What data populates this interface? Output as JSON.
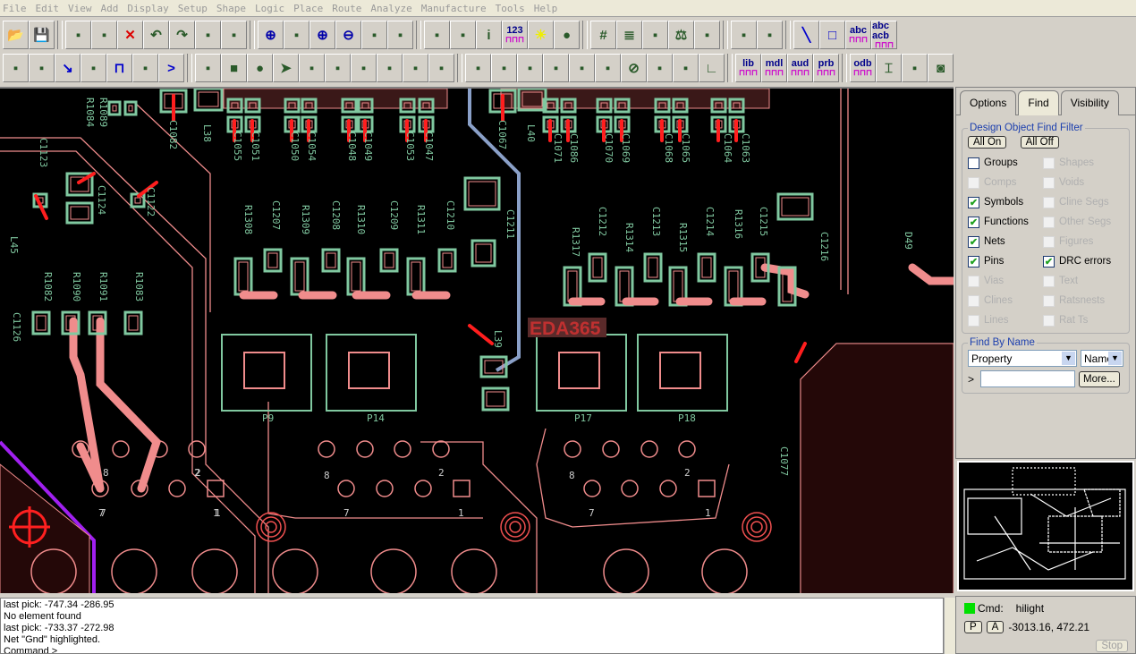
{
  "menu": [
    "File",
    "Edit",
    "View",
    "Add",
    "Display",
    "Setup",
    "Shape",
    "Logic",
    "Place",
    "Route",
    "Analyze",
    "Manufacture",
    "Tools",
    "Help"
  ],
  "toolbar": {
    "row1": [
      {
        "icon": "open-folder-icon"
      },
      {
        "icon": "save-icon"
      },
      {
        "sep": true
      },
      {
        "icon": "move-icon"
      },
      {
        "icon": "copy-icon"
      },
      {
        "icon": "delete-icon"
      },
      {
        "icon": "undo-icon"
      },
      {
        "icon": "redo-icon"
      },
      {
        "icon": "unrats-icon"
      },
      {
        "icon": "pin-icon"
      },
      {
        "sep": true
      },
      {
        "icon": "zoom-fit-icon"
      },
      {
        "icon": "zoom-points-icon"
      },
      {
        "icon": "zoom-in-icon"
      },
      {
        "icon": "zoom-out-icon"
      },
      {
        "icon": "zoom-previous-icon"
      },
      {
        "icon": "redraw-icon"
      },
      {
        "sep": true
      },
      {
        "icon": "color-icon"
      },
      {
        "icon": "color-assign-icon"
      },
      {
        "icon": "info-icon"
      },
      {
        "icon": "measure-icon",
        "label": "123"
      },
      {
        "icon": "highlight-icon"
      },
      {
        "icon": "dehighlight-icon"
      },
      {
        "sep": true
      },
      {
        "icon": "grid-icon"
      },
      {
        "icon": "layers-icon"
      },
      {
        "icon": "visibility-icon"
      },
      {
        "icon": "balance-icon"
      },
      {
        "icon": "board-icon"
      },
      {
        "sep": true
      },
      {
        "icon": "swap-icon"
      },
      {
        "icon": "placement-icon"
      },
      {
        "sep": true
      },
      {
        "icon": "line-icon"
      },
      {
        "icon": "rectangle-icon"
      },
      {
        "icon": "add-text-icon",
        "label": "abc"
      },
      {
        "icon": "change-text-icon",
        "label": "abc acb"
      }
    ],
    "row2": [
      {
        "icon": "connect-icon"
      },
      {
        "icon": "slide-icon"
      },
      {
        "icon": "route-icon"
      },
      {
        "icon": "fanout-icon"
      },
      {
        "icon": "delay-tune-icon"
      },
      {
        "icon": "custom-smooth-icon"
      },
      {
        "icon": "vertex-icon"
      },
      {
        "sep": true
      },
      {
        "icon": "shape-edit-icon"
      },
      {
        "icon": "shape-add-rect-icon"
      },
      {
        "icon": "shape-add-circle-icon"
      },
      {
        "icon": "select-shape-icon"
      },
      {
        "icon": "void-icon"
      },
      {
        "icon": "void-circle-icon"
      },
      {
        "icon": "void-rect-icon"
      },
      {
        "icon": "void-ellipse-icon"
      },
      {
        "icon": "island-icon"
      },
      {
        "icon": "merge-shape-icon"
      },
      {
        "sep": true
      },
      {
        "icon": "dimension-icon"
      },
      {
        "icon": "datum-icon"
      },
      {
        "icon": "linear-dim-icon"
      },
      {
        "icon": "ordinate-dim-icon"
      },
      {
        "icon": "angular-dim-icon"
      },
      {
        "icon": "leader-icon"
      },
      {
        "icon": "diameter-icon"
      },
      {
        "icon": "radius-icon"
      },
      {
        "icon": "balloon-icon"
      },
      {
        "icon": "chamfer-icon"
      },
      {
        "sep": true
      },
      {
        "icon": "lib-icon",
        "label": "lib"
      },
      {
        "icon": "mdl-icon",
        "label": "mdl"
      },
      {
        "icon": "aud-icon",
        "label": "aud"
      },
      {
        "icon": "prb-icon",
        "label": "prb"
      },
      {
        "sep": true
      },
      {
        "icon": "odb-icon",
        "label": "odb"
      },
      {
        "icon": "drill-icon"
      },
      {
        "icon": "drill-legend-icon"
      },
      {
        "icon": "camera-icon"
      }
    ]
  },
  "canvas": {
    "watermark": "EDA365",
    "refdes": [
      "R1084",
      "R1089",
      "C1082",
      "L38",
      "C1055",
      "C1051",
      "C1050",
      "C1054",
      "C1048",
      "C1049",
      "C1053",
      "C1047",
      "C1067",
      "L40",
      "C1071",
      "C1086",
      "C1070",
      "C1069",
      "C1068",
      "C1065",
      "C1064",
      "C1063",
      "C1123",
      "C1124",
      "C1122",
      "L45",
      "R1308",
      "C1207",
      "R1309",
      "C1208",
      "R1310",
      "C1209",
      "R1311",
      "C1210",
      "C1211",
      "R1317",
      "C1212",
      "R1314",
      "C1213",
      "R1315",
      "C1214",
      "R1316",
      "C1215",
      "C1216",
      "D49",
      "R1082",
      "R1090",
      "R1091",
      "R1083",
      "C1126",
      "L39",
      "C1077"
    ],
    "connectors": [
      "P9",
      "P14",
      "P17",
      "P18"
    ],
    "pin_numbers": [
      "8",
      "2",
      "7",
      "1",
      "8",
      "2",
      "7",
      "1",
      "8",
      "2",
      "7",
      "1",
      "2",
      "1",
      "7"
    ],
    "colors": {
      "background": "#000000",
      "pad": "#80c8a0",
      "trace": "#f08c8c",
      "highlight": "#ff1e1e",
      "gnd_net": "#8aa0c8",
      "power": "#a020f0"
    }
  },
  "panel": {
    "tabs": [
      "Options",
      "Find",
      "Visibility"
    ],
    "active_tab": "Find",
    "filter_title": "Design Object Find Filter",
    "all_on": "All On",
    "all_off": "All Off",
    "filters": [
      {
        "label": "Groups",
        "checked": false,
        "enabled": true
      },
      {
        "label": "Shapes",
        "checked": false,
        "enabled": false
      },
      {
        "label": "Comps",
        "checked": false,
        "enabled": false
      },
      {
        "label": "Voids",
        "checked": false,
        "enabled": false
      },
      {
        "label": "Symbols",
        "checked": true,
        "enabled": true
      },
      {
        "label": "Cline Segs",
        "checked": false,
        "enabled": false
      },
      {
        "label": "Functions",
        "checked": true,
        "enabled": true
      },
      {
        "label": "Other Segs",
        "checked": false,
        "enabled": false
      },
      {
        "label": "Nets",
        "checked": true,
        "enabled": true
      },
      {
        "label": "Figures",
        "checked": false,
        "enabled": false
      },
      {
        "label": "Pins",
        "checked": true,
        "enabled": true
      },
      {
        "label": "DRC errors",
        "checked": true,
        "enabled": true
      },
      {
        "label": "Vias",
        "checked": false,
        "enabled": false
      },
      {
        "label": "Text",
        "checked": false,
        "enabled": false
      },
      {
        "label": "Clines",
        "checked": false,
        "enabled": false
      },
      {
        "label": "Ratsnests",
        "checked": false,
        "enabled": false
      },
      {
        "label": "Lines",
        "checked": false,
        "enabled": false
      },
      {
        "label": "Rat Ts",
        "checked": false,
        "enabled": false
      }
    ],
    "find_by_name": "Find By Name",
    "type_select": "Property",
    "name_select": "Name",
    "prompt": ">",
    "name_input": "",
    "more": "More..."
  },
  "console": {
    "lines": [
      "last pick:  -747.34  -286.95",
      "No element found",
      "last pick:  -733.37  -272.98",
      "Net \"Gnd\" highlighted.",
      "Command >"
    ]
  },
  "status": {
    "cmd_label": "Cmd:",
    "cmd": "hilight",
    "status_color": "#00e000",
    "p": "P",
    "a": "A",
    "coords": "-3013.16, 472.21",
    "stop": "Stop"
  }
}
